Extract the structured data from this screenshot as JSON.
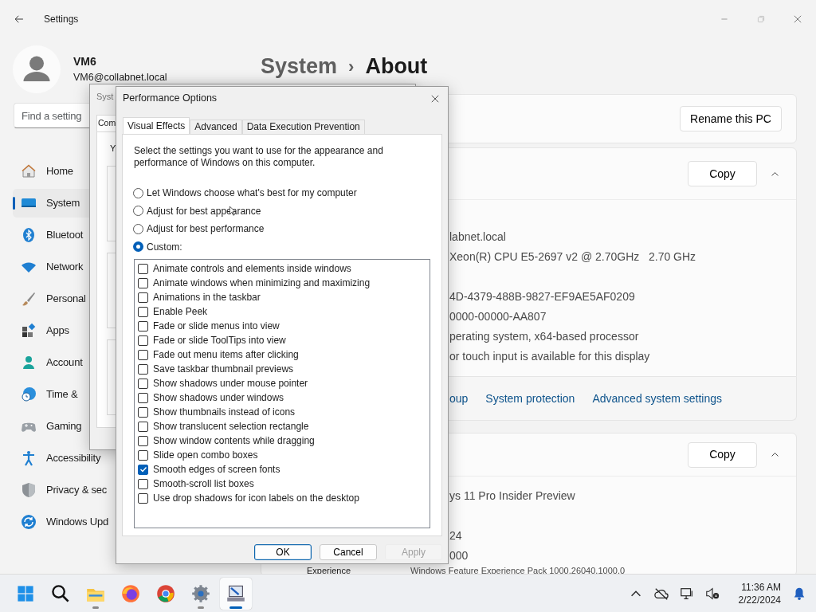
{
  "settings_window": {
    "title": "Settings"
  },
  "profile": {
    "name": "VM6",
    "email": "VM6@collabnet.local"
  },
  "search": {
    "placeholder": "Find a setting"
  },
  "sidebar": {
    "items": [
      {
        "label": "Home",
        "selected": false
      },
      {
        "label": "System",
        "selected": true
      },
      {
        "label": "Bluetoot",
        "selected": false
      },
      {
        "label": "Network",
        "selected": false
      },
      {
        "label": "Personal",
        "selected": false
      },
      {
        "label": "Apps",
        "selected": false
      },
      {
        "label": "Account",
        "selected": false
      },
      {
        "label": "Time &",
        "selected": false
      },
      {
        "label": "Gaming",
        "selected": false
      },
      {
        "label": "Accessibility",
        "selected": false
      },
      {
        "label": "Privacy & sec",
        "selected": false
      },
      {
        "label": "Windows Upd",
        "selected": false
      }
    ]
  },
  "breadcrumb": {
    "parent": "System",
    "separator": "›",
    "current": "About"
  },
  "rename_card": {
    "button": "Rename this PC"
  },
  "device_specs": {
    "button": "Copy",
    "expanded": true,
    "rows": [
      "labnet.local",
      "Xeon(R) CPU E5-2697 v2 @ 2.70GHz   2.70 GHz",
      "4D-4379-488B-9827-EF9AE5AF0209",
      "0000-00000-AA807",
      "perating system, x64-based processor",
      "or touch input is available for this display"
    ]
  },
  "related_links": [
    "oup",
    "System protection",
    "Advanced system settings"
  ],
  "windows_specs": {
    "button": "Copy",
    "expanded": true,
    "rows": [
      "ys 11 Pro Insider Preview",
      "24",
      "000"
    ],
    "last_row": {
      "label": "Experience",
      "value": "Windows Feature Experience Pack 1000.26040.1000.0"
    }
  },
  "system_properties": {
    "title": "Syst",
    "tab": "Com",
    "text": "Y"
  },
  "performance_options": {
    "title": "Performance Options",
    "tabs": [
      {
        "label": "Visual Effects",
        "selected": true
      },
      {
        "label": "Advanced",
        "selected": false
      },
      {
        "label": "Data Execution Prevention",
        "selected": false
      }
    ],
    "description": "Select the settings you want to use for the appearance and performance of Windows on this computer.",
    "radios": [
      {
        "label": "Let Windows choose what's best for my computer",
        "selected": false
      },
      {
        "label": "Adjust for best appearance",
        "selected": false
      },
      {
        "label": "Adjust for best performance",
        "selected": false
      },
      {
        "label": "Custom:",
        "selected": true
      }
    ],
    "effects": [
      {
        "label": "Animate controls and elements inside windows",
        "checked": false
      },
      {
        "label": "Animate windows when minimizing and maximizing",
        "checked": false
      },
      {
        "label": "Animations in the taskbar",
        "checked": false
      },
      {
        "label": "Enable Peek",
        "checked": false
      },
      {
        "label": "Fade or slide menus into view",
        "checked": false
      },
      {
        "label": "Fade or slide ToolTips into view",
        "checked": false
      },
      {
        "label": "Fade out menu items after clicking",
        "checked": false
      },
      {
        "label": "Save taskbar thumbnail previews",
        "checked": false
      },
      {
        "label": "Show shadows under mouse pointer",
        "checked": false
      },
      {
        "label": "Show shadows under windows",
        "checked": false
      },
      {
        "label": "Show thumbnails instead of icons",
        "checked": false
      },
      {
        "label": "Show translucent selection rectangle",
        "checked": false
      },
      {
        "label": "Show window contents while dragging",
        "checked": false
      },
      {
        "label": "Slide open combo boxes",
        "checked": false
      },
      {
        "label": "Smooth edges of screen fonts",
        "checked": true
      },
      {
        "label": "Smooth-scroll list boxes",
        "checked": false
      },
      {
        "label": "Use drop shadows for icon labels on the desktop",
        "checked": false
      }
    ],
    "buttons": [
      {
        "label": "OK",
        "default": true,
        "disabled": false
      },
      {
        "label": "Cancel",
        "default": false,
        "disabled": false
      },
      {
        "label": "Apply",
        "default": false,
        "disabled": true
      }
    ]
  },
  "taskbar": {
    "apps": [
      {
        "running": false,
        "selected": false
      },
      {
        "running": false,
        "selected": false
      },
      {
        "running": true,
        "selected": false
      },
      {
        "running": false,
        "selected": false
      },
      {
        "running": false,
        "selected": false
      },
      {
        "running": true,
        "selected": false
      },
      {
        "running": true,
        "selected": true
      }
    ],
    "clock": {
      "time": "11:36 AM",
      "date": "2/22/2024"
    }
  }
}
